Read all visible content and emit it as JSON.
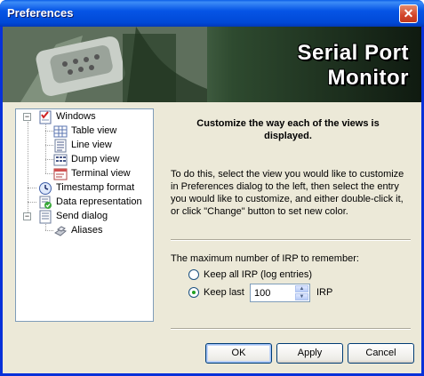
{
  "window": {
    "title": "Preferences",
    "close_symbol": "✕"
  },
  "banner": {
    "line1": "Serial Port",
    "line2": "Monitor"
  },
  "tree": {
    "windows": "Windows",
    "table_view": "Table view",
    "line_view": "Line view",
    "dump_view": "Dump view",
    "terminal_view": "Terminal view",
    "timestamp_format": "Timestamp format",
    "data_representation": "Data representation",
    "send_dialog": "Send dialog",
    "aliases": "Aliases",
    "collapse_symbol": "−"
  },
  "panel": {
    "heading": "Customize the way each of the views is displayed.",
    "description": "To do this, select the view you would like to customize in Preferences dialog to the left, then select the entry you would like to customize, and either double-click it, or click \"Change\" button to set new color."
  },
  "irp": {
    "label": "The maximum number of IRP to remember:",
    "keep_all": "Keep all IRP (log entries)",
    "keep_last": "Keep last",
    "keep_last_value": "100",
    "unit": "IRP",
    "selected": "keep_last"
  },
  "buttons": {
    "ok": "OK",
    "apply": "Apply",
    "cancel": "Cancel"
  }
}
